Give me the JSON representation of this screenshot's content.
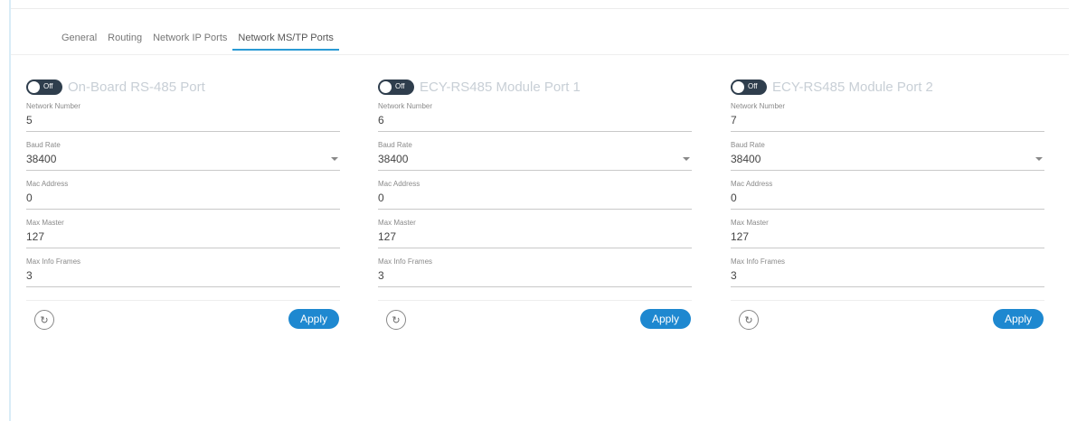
{
  "tabs": [
    {
      "label": "General",
      "active": false
    },
    {
      "label": "Routing",
      "active": false
    },
    {
      "label": "Network IP Ports",
      "active": false
    },
    {
      "label": "Network MS/TP Ports",
      "active": true
    }
  ],
  "accent_color": "#1e88d0",
  "ports": [
    {
      "toggle_label": "Off",
      "title": "On-Board RS-485 Port",
      "fields": [
        {
          "label": "Network Number",
          "value": "5"
        },
        {
          "label": "Baud Rate",
          "value": "38400"
        },
        {
          "label": "Mac Address",
          "value": "0"
        },
        {
          "label": "Max Master",
          "value": "127"
        },
        {
          "label": "Max Info Frames",
          "value": "3"
        }
      ],
      "refresh_icon": "refresh-icon",
      "apply_label": "Apply"
    },
    {
      "toggle_label": "Off",
      "title": "ECY-RS485 Module Port 1",
      "fields": [
        {
          "label": "Network Number",
          "value": "6"
        },
        {
          "label": "Baud Rate",
          "value": "38400"
        },
        {
          "label": "Mac Address",
          "value": "0"
        },
        {
          "label": "Max Master",
          "value": "127"
        },
        {
          "label": "Max Info Frames",
          "value": "3"
        }
      ],
      "refresh_icon": "refresh-icon",
      "apply_label": "Apply"
    },
    {
      "toggle_label": "Off",
      "title": "ECY-RS485 Module Port 2",
      "fields": [
        {
          "label": "Network Number",
          "value": "7"
        },
        {
          "label": "Baud Rate",
          "value": "38400"
        },
        {
          "label": "Mac Address",
          "value": "0"
        },
        {
          "label": "Max Master",
          "value": "127"
        },
        {
          "label": "Max Info Frames",
          "value": "3"
        }
      ],
      "refresh_icon": "refresh-icon",
      "apply_label": "Apply"
    }
  ]
}
